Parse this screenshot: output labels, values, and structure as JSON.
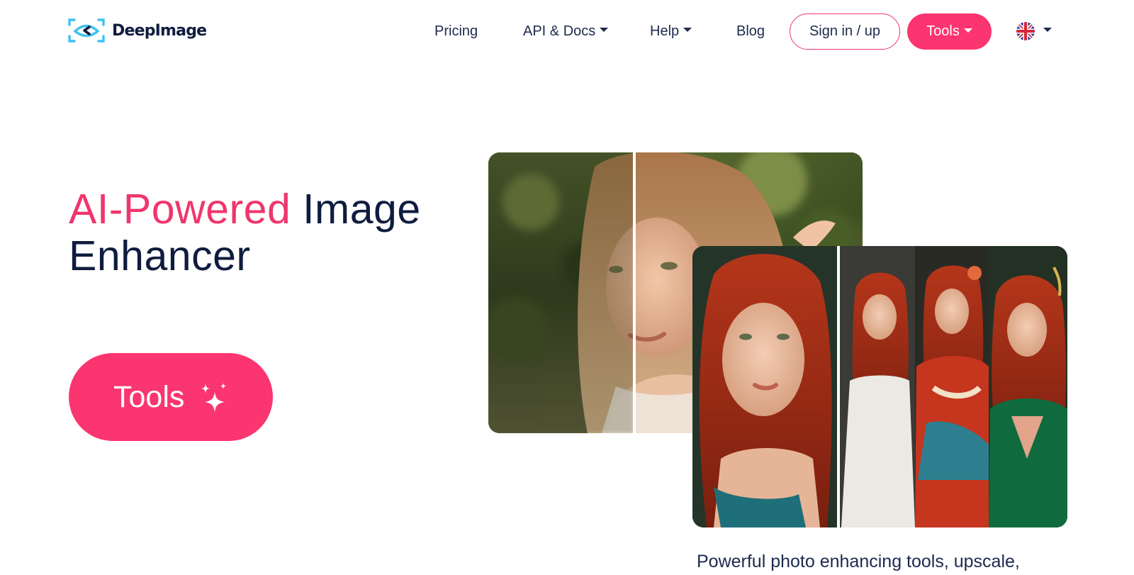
{
  "brand": {
    "name": "DeepImage",
    "accent_color": "#fb356f",
    "text_color": "#0f1c3f"
  },
  "nav": {
    "pricing": "Pricing",
    "api_docs": "API & Docs",
    "help": "Help",
    "blog": "Blog",
    "sign_in": "Sign in / up",
    "tools": "Tools",
    "language_icon": "uk-flag-icon"
  },
  "hero": {
    "title_accent": "AI-Powered",
    "title_rest": " Image",
    "title_line2": "Enhancer",
    "cta_label": "Tools",
    "cta_icon": "sparkle-icon"
  },
  "images": {
    "before_after_portrait": "blonde-woman-before-after-photo",
    "ai_variants": "red-haired-woman-ai-variations-photo"
  },
  "tagline": "Powerful photo enhancing tools, upscale,"
}
